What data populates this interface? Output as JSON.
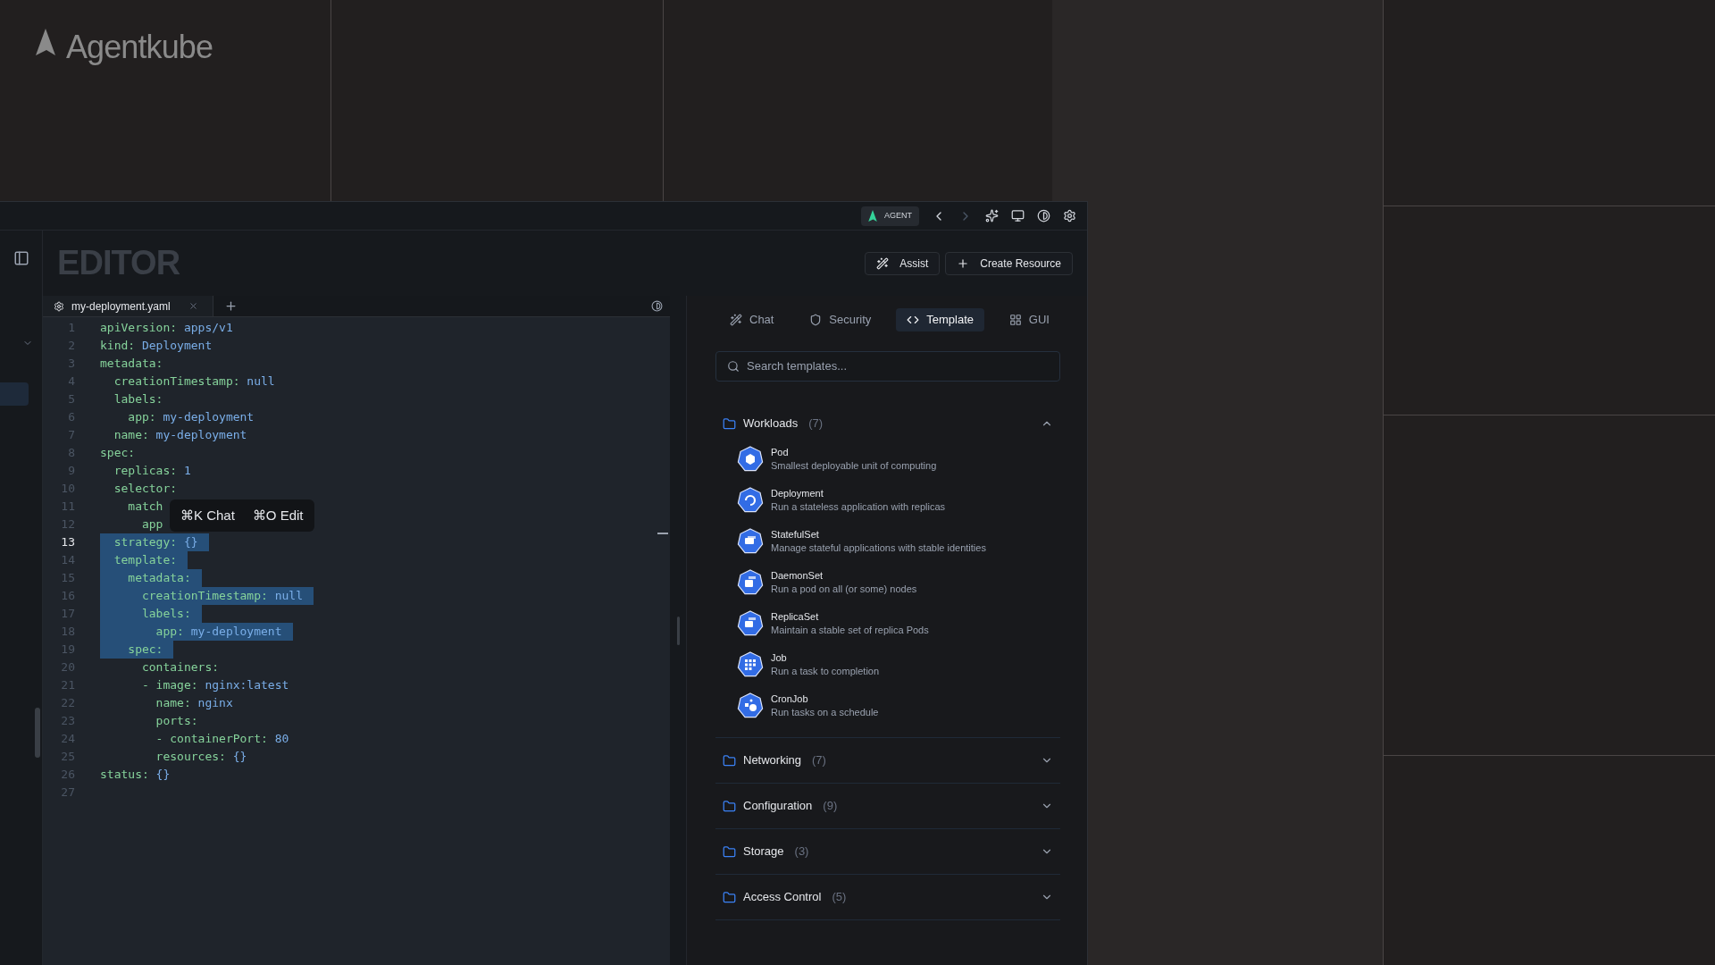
{
  "brand": {
    "name": "Agentkube"
  },
  "toolbar": {
    "agent_badge": "AGENT",
    "back_disabled": false,
    "forward_disabled": true
  },
  "header": {
    "title": "EDITOR",
    "buttons": [
      {
        "label": "Assist"
      },
      {
        "label": "Create Resource"
      }
    ]
  },
  "editor": {
    "tabs": [
      {
        "label": "my-deployment.yaml",
        "selected": true
      }
    ],
    "lines": [
      {
        "number": "1",
        "key": "apiVersion:",
        "value": "apps/v1",
        "selected": false,
        "active": false
      },
      {
        "number": "2",
        "key": "kind:",
        "value": "Deployment",
        "selected": false,
        "active": false
      },
      {
        "number": "3",
        "key": "metadata:",
        "selected": false,
        "active": false
      },
      {
        "number": "4",
        "key": "  creationTimestamp:",
        "value": "null",
        "selected": false,
        "active": false
      },
      {
        "number": "5",
        "key": "  labels:",
        "selected": false,
        "active": false
      },
      {
        "number": "6",
        "key": "    app:",
        "value": "my-deployment",
        "selected": false,
        "active": false
      },
      {
        "number": "7",
        "key": "  name:",
        "value": "my-deployment",
        "selected": false,
        "active": false
      },
      {
        "number": "8",
        "key": "spec:",
        "selected": false,
        "active": false
      },
      {
        "number": "9",
        "key": "  replicas:",
        "value": "1",
        "selected": false,
        "active": false
      },
      {
        "number": "10",
        "key": "  selector:",
        "selected": false,
        "active": false
      },
      {
        "number": "11",
        "key": "    match",
        "selected": false,
        "active": false
      },
      {
        "number": "12",
        "key": "      app",
        "selected": false,
        "active": false
      },
      {
        "number": "13",
        "key": "  strategy:",
        "value": "{}",
        "selected": true,
        "active": true
      },
      {
        "number": "14",
        "key": "  template:",
        "selected": true,
        "active": false
      },
      {
        "number": "15",
        "key": "    metadata:",
        "selected": true,
        "active": false
      },
      {
        "number": "16",
        "key": "      creationTimestamp:",
        "value": "null",
        "selected": true,
        "active": false
      },
      {
        "number": "17",
        "key": "      labels:",
        "selected": true,
        "active": false
      },
      {
        "number": "18",
        "key": "        app:",
        "value": "my-deployment",
        "selected": true,
        "active": false
      },
      {
        "number": "19",
        "key": "    spec:",
        "selected": true,
        "active": false
      },
      {
        "number": "20",
        "key": "      containers:",
        "selected": false,
        "active": false
      },
      {
        "number": "21",
        "key": "      - image:",
        "value": "nginx:latest",
        "selected": false,
        "active": false
      },
      {
        "number": "22",
        "key": "        name:",
        "value": "nginx",
        "selected": false,
        "active": false
      },
      {
        "number": "23",
        "key": "        ports:",
        "selected": false,
        "active": false
      },
      {
        "number": "24",
        "key": "        - containerPort:",
        "value": "80",
        "selected": false,
        "active": false
      },
      {
        "number": "25",
        "key": "        resources:",
        "value": "{}",
        "selected": false,
        "active": false
      },
      {
        "number": "26",
        "key": "status:",
        "value": "{}",
        "selected": false,
        "active": false
      },
      {
        "number": "27",
        "selected": false,
        "active": false
      }
    ],
    "popup": {
      "actions": [
        {
          "shortcut": "⌘K",
          "label": "Chat"
        },
        {
          "shortcut": "⌘O",
          "label": "Edit"
        }
      ]
    }
  },
  "panel": {
    "tabs": [
      {
        "label": "Chat",
        "selected": false
      },
      {
        "label": "Security",
        "selected": false
      },
      {
        "label": "Template",
        "selected": true
      },
      {
        "label": "GUI",
        "selected": false
      }
    ],
    "search": {
      "placeholder": "Search templates..."
    },
    "groups": [
      {
        "name": "Workloads",
        "count": "(7)",
        "expanded": true,
        "items": [
          {
            "name": "Pod",
            "description": "Smallest deployable unit of computing"
          },
          {
            "name": "Deployment",
            "description": "Run a stateless application with replicas"
          },
          {
            "name": "StatefulSet",
            "description": "Manage stateful applications with stable identities"
          },
          {
            "name": "DaemonSet",
            "description": "Run a pod on all (or some) nodes"
          },
          {
            "name": "ReplicaSet",
            "description": "Maintain a stable set of replica Pods"
          },
          {
            "name": "Job",
            "description": "Run a task to completion"
          },
          {
            "name": "CronJob",
            "description": "Run tasks on a schedule"
          }
        ]
      },
      {
        "name": "Networking",
        "count": "(7)",
        "expanded": false
      },
      {
        "name": "Configuration",
        "count": "(9)",
        "expanded": false
      },
      {
        "name": "Storage",
        "count": "(3)",
        "expanded": false
      },
      {
        "name": "Access Control",
        "count": "(5)",
        "expanded": false
      }
    ]
  }
}
